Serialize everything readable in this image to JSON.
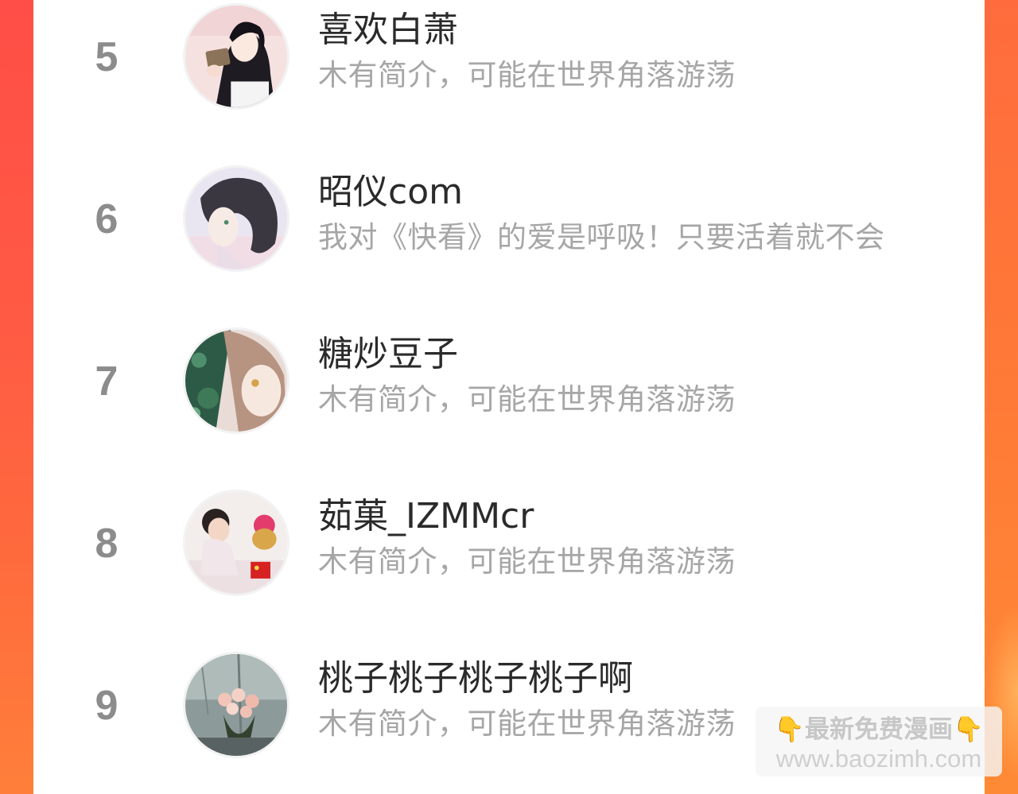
{
  "ranking": {
    "rows": [
      {
        "rank": "5",
        "name": "喜欢白萧",
        "intro": "木有简介，可能在世界角落游荡",
        "avatar": "avatar-anime-girl-black-hair"
      },
      {
        "rank": "6",
        "name": "昭仪com",
        "intro": "我对《快看》的爱是呼吸！只要活着就不会",
        "avatar": "avatar-anime-boy-profile"
      },
      {
        "rank": "7",
        "name": "糖炒豆子",
        "intro": "木有简介，可能在世界角落游荡",
        "avatar": "avatar-anime-girl-flowers"
      },
      {
        "rank": "8",
        "name": "茹菓_IZMMcr",
        "intro": "木有简介，可能在世界角落游荡",
        "avatar": "avatar-baby-photo"
      },
      {
        "rank": "9",
        "name": "桃子桃子桃子桃子啊",
        "intro": "木有简介，可能在世界角落游荡",
        "avatar": "avatar-roses-photo"
      }
    ]
  },
  "watermark": {
    "icon_left": "👇",
    "text": "最新免费漫画",
    "icon_right": "👇",
    "url": "www.baozimh.com"
  },
  "colors": {
    "border_gradient_top": "#ff4e47",
    "border_gradient_bottom": "#ff7f3a",
    "rank_number": "#8c8c8c",
    "name_text": "#2a2a2a",
    "intro_text": "#a6a6a6"
  }
}
